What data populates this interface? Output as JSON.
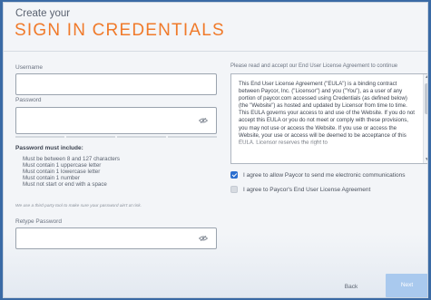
{
  "header": {
    "pre_title": "Create your",
    "title": "SIGN IN CREDENTIALS"
  },
  "form": {
    "username_label": "Username",
    "username_value": "",
    "password_label": "Password",
    "password_value": "",
    "requirements_heading": "Password must include:",
    "requirements": [
      "Must be between 8 and 127 characters",
      "Must contain 1 uppercase letter",
      "Must contain 1 lowercase letter",
      "Must contain 1 number",
      "Must not start or end with a space"
    ],
    "third_party_note": "We use a third party tool to make sure your password ain't at risk.",
    "retype_label": "Retype Password",
    "retype_value": ""
  },
  "eula": {
    "prompt": "Please read and accept our End User License Agreement to continue",
    "text": "This End User License Agreement (\"EULA\") is a binding contract between Paycor, Inc. (\"Licensor\") and you (\"You\"), as a user of any portion of paycor.com accessed using Credentials (as defined below) (the \"Website\") as hosted and updated by Licensor from time to time. This EULA governs your access to and use of the Website. If you do not accept this EULA or you do not meet or comply with these provisions, you may not use or access the Website. If you use or access the Website, your use or access will be deemed to be acceptance of this EULA. Licensor reserves the right to"
  },
  "checkboxes": [
    {
      "label": "I agree to allow Paycor to send me electronic communications",
      "checked": true
    },
    {
      "label": "I agree to Paycor's End User License Agreement",
      "checked": false
    }
  ],
  "footer": {
    "back_label": "Back",
    "next_label": "Next"
  },
  "icons": {
    "password_toggle": "eye-slash-icon",
    "retype_toggle": "eye-slash-icon"
  },
  "colors": {
    "accent": "#f07a2a",
    "primary": "#2c6fcf",
    "next_disabled": "#a9c9ee"
  }
}
